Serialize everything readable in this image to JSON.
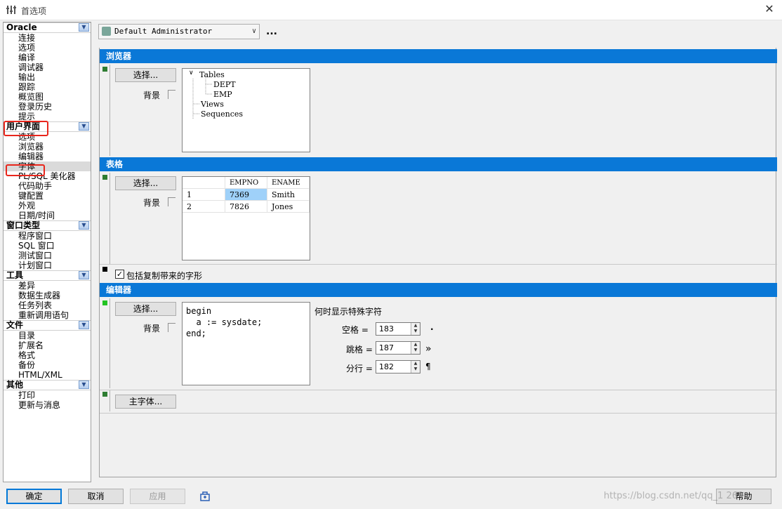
{
  "window": {
    "title": "首选项"
  },
  "nav": {
    "groups": [
      {
        "label": "Oracle",
        "items": [
          "连接",
          "选项",
          "编译",
          "调试器",
          "输出",
          "跟踪",
          "概览图",
          "登录历史",
          "提示"
        ]
      },
      {
        "label": "用户界面",
        "items": [
          "选项",
          "浏览器",
          "编辑器",
          "字体",
          "PL/SQL 美化器",
          "代码助手",
          "键配置",
          "外观",
          "日期/时间"
        ]
      },
      {
        "label": "窗口类型",
        "items": [
          "程序窗口",
          "SQL 窗口",
          "测试窗口",
          "计划窗口"
        ]
      },
      {
        "label": "工具",
        "items": [
          "差异",
          "数据生成器",
          "任务列表",
          "重新调用语句"
        ]
      },
      {
        "label": "文件",
        "items": [
          "目录",
          "扩展名",
          "格式",
          "备份",
          "HTML/XML"
        ]
      },
      {
        "label": "其他",
        "items": [
          "打印",
          "更新与消息"
        ]
      }
    ],
    "selected": "字体"
  },
  "profile": {
    "value": "Default Administrator",
    "more": "..."
  },
  "browser_section": {
    "title": "浏览器",
    "select_label": "选择...",
    "background_label": "背景",
    "tree": {
      "root": "Tables",
      "children": [
        "DEPT",
        "EMP"
      ],
      "siblings": [
        "Views",
        "Sequences"
      ]
    }
  },
  "grid_section": {
    "title": "表格",
    "select_label": "选择...",
    "background_label": "背景",
    "columns": [
      "",
      "EMPNO",
      "ENAME"
    ],
    "rows": [
      [
        "1",
        "7369",
        "Smith"
      ],
      [
        "2",
        "7826",
        "Jones"
      ]
    ]
  },
  "include_copy_font": {
    "label": "包括复制带来的字形",
    "checked": true
  },
  "editor_section": {
    "title": "编辑器",
    "select_label": "选择...",
    "background_label": "背景",
    "code": "begin\n  a := sysdate;\nend;",
    "special_chars_title": "何时显示特殊字符",
    "space_label": "空格 =",
    "space_value": "183",
    "space_symbol": ".",
    "tab_label": "跳格 =",
    "tab_value": "187",
    "tab_symbol": "»",
    "line_label": "分行 =",
    "line_value": "182",
    "line_symbol": "¶"
  },
  "main_font": {
    "label": "主字体..."
  },
  "buttons": {
    "ok": "确定",
    "cancel": "取消",
    "apply": "应用",
    "help": "帮助"
  },
  "watermark": "https://blog.csdn.net/qq_1 269",
  "colors": {
    "section_header": "#0a78d7",
    "marker_green": "#2e7d32",
    "marker_black": "#000000",
    "highlight": "#e8261c"
  }
}
